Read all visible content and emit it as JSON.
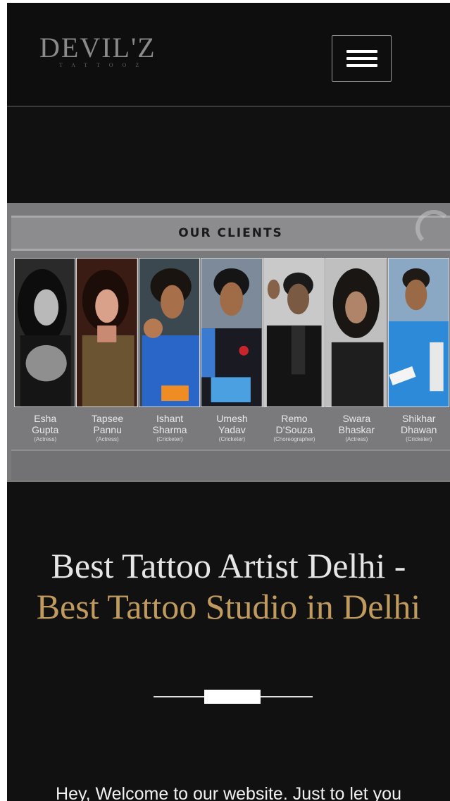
{
  "header": {
    "logo_main": "DEVIL'Z",
    "logo_sub": "TATTOOZ",
    "menu_icon": "hamburger-menu-icon"
  },
  "banner": {
    "title": "OUR CLIENTS",
    "clients": [
      {
        "first": "Esha",
        "last": "Gupta",
        "role": "(Actress)"
      },
      {
        "first": "Tapsee",
        "last": "Pannu",
        "role": "(Actress)"
      },
      {
        "first": "Ishant",
        "last": "Sharma",
        "role": "(Cricketer)"
      },
      {
        "first": "Umesh",
        "last": "Yadav",
        "role": "(Cricketer)"
      },
      {
        "first": "Remo",
        "last": "D'Souza",
        "role": "(Choreographer)"
      },
      {
        "first": "Swara",
        "last": "Bhaskar",
        "role": "(Actress)"
      },
      {
        "first": "Shikhar",
        "last": "Dhawan",
        "role": "(Cricketer)"
      }
    ]
  },
  "main": {
    "heading_white": "Best Tattoo Artist Delhi -",
    "heading_gold": "Best Tattoo Studio in Delhi",
    "welcome": "Hey, Welcome to our website. Just to let you"
  },
  "colors": {
    "background": "#111112",
    "accent_gold": "#c19a5e",
    "banner_gray": "#7a7a7c"
  }
}
